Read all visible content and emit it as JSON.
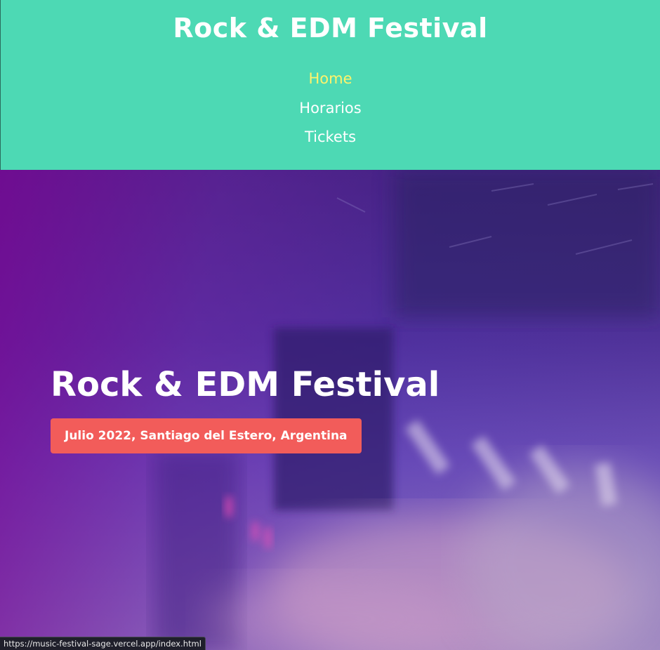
{
  "header": {
    "title": "Rock & EDM Festival",
    "nav": [
      {
        "label": "Home",
        "active": true
      },
      {
        "label": "Horarios",
        "active": false
      },
      {
        "label": "Tickets",
        "active": false
      }
    ]
  },
  "hero": {
    "title": "Rock & EDM Festival",
    "badge": "Julio 2022, Santiago del Estero, Argentina"
  },
  "status_bar": {
    "url": "https://music-festival-sage.vercel.app/index.html"
  },
  "colors": {
    "header_bg": "#4dd9b4",
    "nav_active": "#fff36b",
    "badge_bg": "#f25c5a",
    "hero_tint": "#7a1fa2"
  }
}
